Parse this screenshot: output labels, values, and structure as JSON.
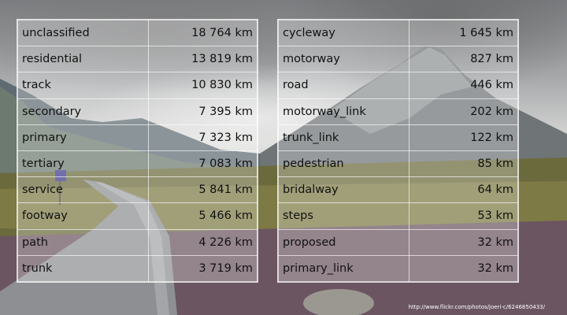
{
  "left_table": [
    {
      "type": "unclassified",
      "length": "18 764 km"
    },
    {
      "type": "residential",
      "length": "13 819 km"
    },
    {
      "type": "track",
      "length": "10 830 km"
    },
    {
      "type": "secondary",
      "length": "7 395 km"
    },
    {
      "type": "primary",
      "length": "7 323 km"
    },
    {
      "type": "tertiary",
      "length": "7 083 km"
    },
    {
      "type": "service",
      "length": "5 841 km"
    },
    {
      "type": "footway",
      "length": "5 466 km"
    },
    {
      "type": "path",
      "length": "4 226 km"
    },
    {
      "type": "trunk",
      "length": "3 719 km"
    }
  ],
  "right_table": [
    {
      "type": "cycleway",
      "length": "1 645 km"
    },
    {
      "type": "motorway",
      "length": "827 km"
    },
    {
      "type": "road",
      "length": "446 km"
    },
    {
      "type": "motorway_link",
      "length": "202 km"
    },
    {
      "type": "trunk_link",
      "length": "122 km"
    },
    {
      "type": "pedestrian",
      "length": "85 km"
    },
    {
      "type": "bridalway",
      "length": "64 km"
    },
    {
      "type": "steps",
      "length": "53 km"
    },
    {
      "type": "proposed",
      "length": "32 km"
    },
    {
      "type": "primary_link",
      "length": "32 km"
    }
  ],
  "photo_credit": "http://www.flickr.com/photos/joeri-c/6246850433/"
}
